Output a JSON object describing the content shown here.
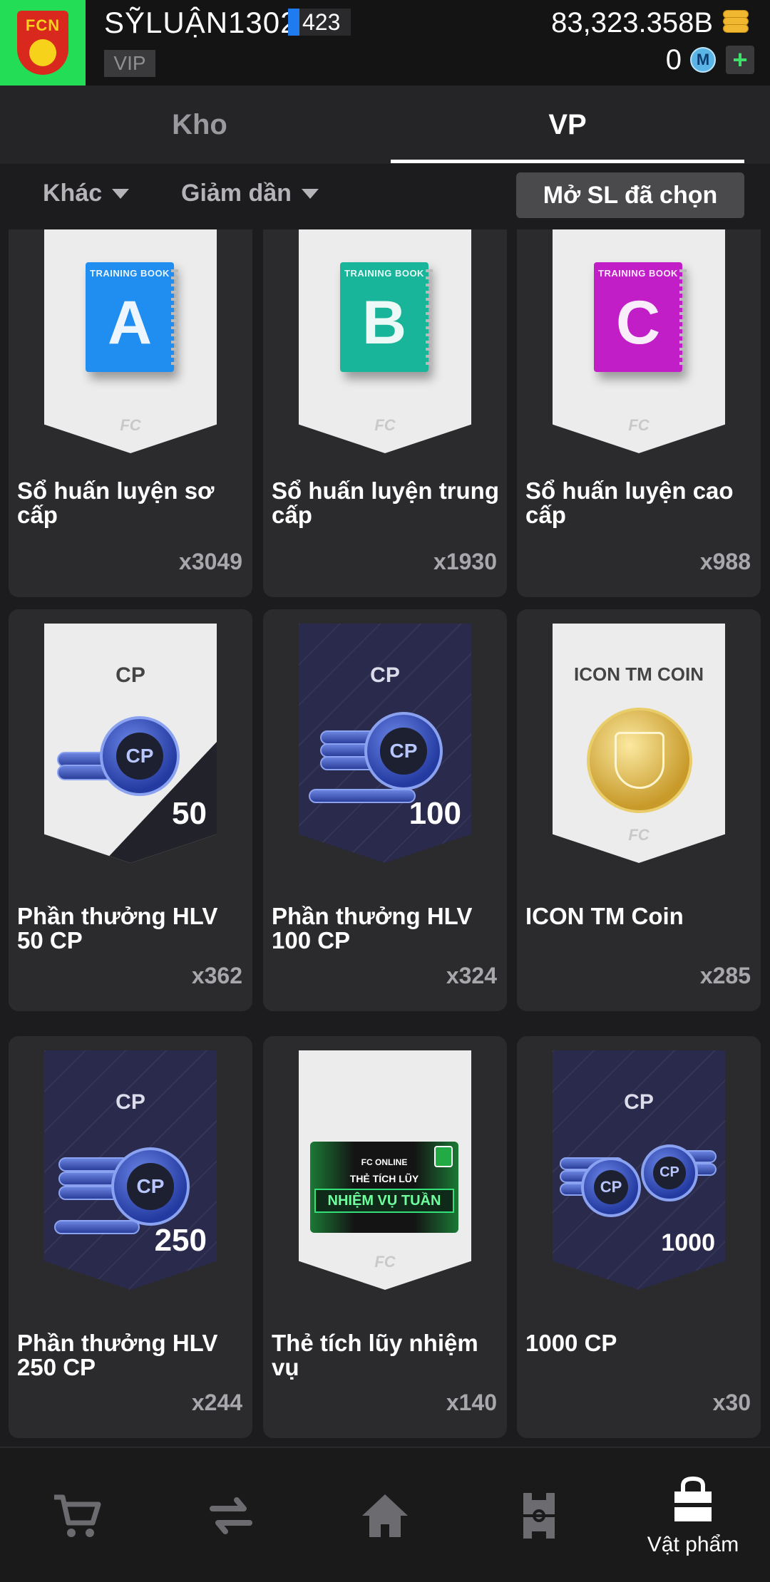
{
  "header": {
    "username": "SỸLUẬN1302",
    "level": "423",
    "vip_label": "VIP",
    "coins": "83,323.358B",
    "m_count": "0",
    "m_icon_letter": "M",
    "plus": "+",
    "logo_text": "FCN",
    "colors": {
      "logo_bg": "#22dd55",
      "level_bar": "#1e7bf0"
    }
  },
  "tabs": [
    {
      "label": "Kho",
      "active": false
    },
    {
      "label": "VP",
      "active": true
    }
  ],
  "filters": {
    "category": "Khác",
    "sort": "Giảm dần",
    "open_selected": "Mở SL đã chọn"
  },
  "items": [
    {
      "name": "Sổ huấn luyện sơ cấp",
      "qty": "x3049",
      "art": "book",
      "book_letter": "A",
      "book_title": "TRAINING BOOK",
      "book_color": "#1f8ef0"
    },
    {
      "name": "Sổ huấn luyện trung cấp",
      "qty": "x1930",
      "art": "book",
      "book_letter": "B",
      "book_title": "TRAINING BOOK",
      "book_color": "#18b59a"
    },
    {
      "name": "Sổ huấn luyện cao cấp",
      "qty": "x988",
      "art": "book",
      "book_letter": "C",
      "book_title": "TRAINING BOOK",
      "book_color": "#c21ec8"
    },
    {
      "name": "Phần thưởng HLV 50 CP",
      "qty": "x362",
      "art": "cp",
      "top_text": "CP",
      "number": "50",
      "coin_label": "CP"
    },
    {
      "name": "Phần thưởng HLV 100 CP",
      "qty": "x324",
      "art": "cp",
      "top_text": "CP",
      "number": "100",
      "coin_label": "CP"
    },
    {
      "name": "ICON TM Coin",
      "qty": "x285",
      "art": "gold",
      "top_text": "ICON TM COIN"
    },
    {
      "name": "Phần thưởng HLV 250 CP",
      "qty": "x244",
      "art": "cp",
      "top_text": "CP",
      "number": "250",
      "coin_label": "CP"
    },
    {
      "name": "Thẻ tích lũy nhiệm vụ",
      "qty": "x140",
      "art": "mission",
      "m_brand": "FC ONLINE",
      "m_line1": "THẺ TÍCH LŨY",
      "m_line2": "NHIỆM VỤ TUẦN"
    },
    {
      "name": "1000 CP",
      "qty": "x30",
      "art": "cp",
      "top_text": "CP",
      "number": "1000",
      "coin_label": "CP"
    }
  ],
  "bottom_nav": [
    {
      "icon": "cart-icon",
      "label": ""
    },
    {
      "icon": "transfer-icon",
      "label": ""
    },
    {
      "icon": "home-icon",
      "label": ""
    },
    {
      "icon": "field-icon",
      "label": ""
    },
    {
      "icon": "bag-icon",
      "label": "Vật phẩm",
      "active": true
    }
  ]
}
